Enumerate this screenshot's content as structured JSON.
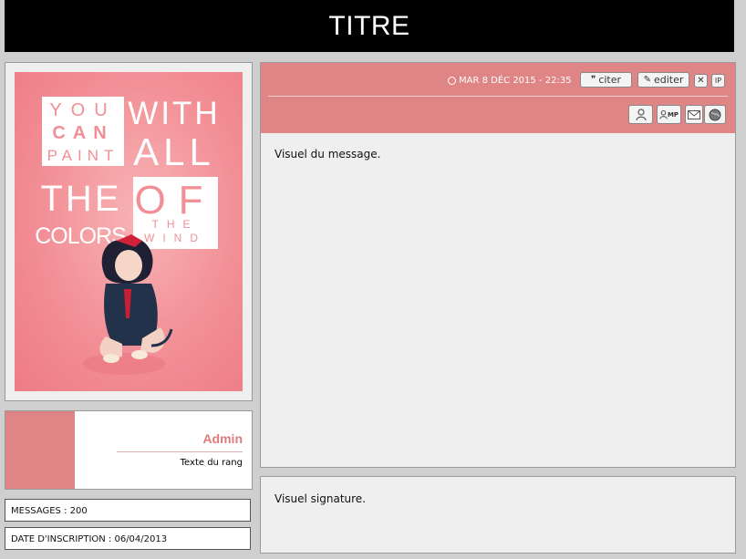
{
  "header": {
    "title": "TITRE"
  },
  "avatar": {
    "words": [
      "YOU",
      "CAN",
      "PAINT",
      "WITH",
      "ALL",
      "THE",
      "OF",
      "COLORS",
      "THE",
      "WIND"
    ]
  },
  "rank": {
    "name": "Admin",
    "subtitle": "Texte du rang",
    "color": "#df8585"
  },
  "profile": {
    "messages": "MESSAGES : 200",
    "registered": "DATE D'INSCRIPTION : 06/04/2013"
  },
  "post": {
    "date": "MAR 8 DÉC 2015 - 22:35",
    "quote_label": "citer",
    "edit_label": "editer",
    "delete_label": "✕",
    "ip_label": "IP",
    "pm_label": "MP",
    "body": "Visuel du message.",
    "signature": "Visuel signature."
  },
  "colors": {
    "accent": "#df8585",
    "title_bar": "#000000",
    "page_bg": "#cfcfcf"
  }
}
